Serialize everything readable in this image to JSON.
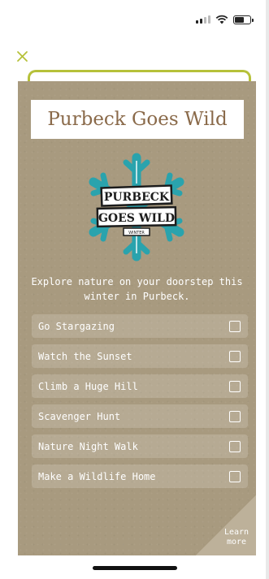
{
  "status_bar": {
    "signal_icon": "cellular-signal-icon",
    "wifi_icon": "wifi-icon",
    "battery_icon": "battery-icon",
    "battery_level": 0.7
  },
  "close_icon": "close-icon",
  "colors": {
    "accent": "#b6c13a",
    "card": "#a89a7f",
    "title_text": "#8a6a4a",
    "logo_teal": "#2aa3ad"
  },
  "card": {
    "title": "Purbeck Goes Wild",
    "logo": {
      "line1": "PURBECK",
      "line2": "GOES WILD",
      "line3": "WINTER"
    },
    "intro": "Explore nature on your doorstep this winter in Purbeck.",
    "activities": [
      {
        "label": "Go Stargazing",
        "checked": false
      },
      {
        "label": "Watch the Sunset",
        "checked": false
      },
      {
        "label": "Climb a Huge Hill",
        "checked": false
      },
      {
        "label": "Scavenger Hunt",
        "checked": false
      },
      {
        "label": "Nature Night Walk",
        "checked": false
      },
      {
        "label": "Make a Wildlife Home",
        "checked": false
      }
    ],
    "learn_more": "Learn more"
  }
}
